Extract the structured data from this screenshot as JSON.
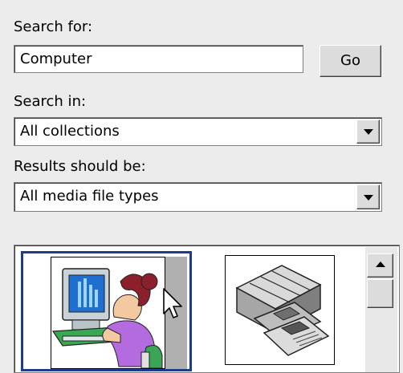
{
  "search": {
    "label": "Search for:",
    "value": "Computer",
    "go_label": "Go"
  },
  "search_in": {
    "label": "Search in:",
    "value": "All collections"
  },
  "results_type": {
    "label": "Results should be:",
    "value": "All media file types"
  },
  "results": {
    "items": [
      {
        "icon": "woman-at-computer-clipart",
        "selected": true
      },
      {
        "icon": "floppy-disks-clipart",
        "selected": false
      }
    ]
  },
  "colors": {
    "selection_border": "#1f3b8c",
    "panel_background": "#ececec"
  }
}
